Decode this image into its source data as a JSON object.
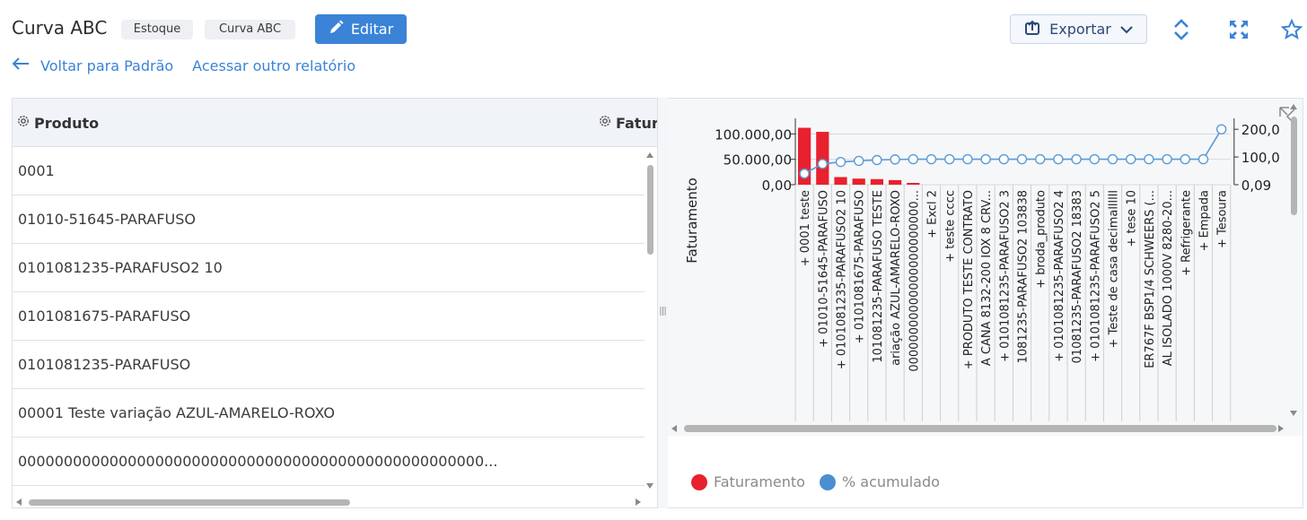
{
  "header": {
    "title": "Curva ABC",
    "chips": [
      "Estoque",
      "Curva ABC"
    ],
    "edit_label": "Editar",
    "export_label": "Exportar",
    "back_link": "Voltar para Padrão",
    "other_report_link": "Acessar outro relatório"
  },
  "table": {
    "columns": [
      "Produto",
      "Fatur"
    ],
    "rows": [
      "0001",
      "01010-51645-PARAFUSO",
      "0101081235-PARAFUSO2 10",
      "0101081675-PARAFUSO",
      "0101081235-PARAFUSO",
      "00001 Teste variação AZUL-AMARELO-ROXO",
      "000000000000000000000000000000000000000000000000000..."
    ]
  },
  "chart_data": {
    "type": "bar",
    "ylabel": "Faturamento",
    "y_ticks": [
      "100.000,00",
      "50.000,00",
      "0,00"
    ],
    "y2_ticks": [
      "200,0",
      "100,0",
      "0,09"
    ],
    "categories": [
      "+ 0001 teste",
      "+ 01010-51645-PARAFUSO",
      "+ 0101081235-PARAFUSO2 10",
      "+ 0101081675-PARAFUSO",
      "101081235-PARAFUSO TESTE",
      "ariação AZUL-AMARELO-ROXO",
      "00000000000000000000000...",
      "+ Excl 2",
      "+ teste cccc",
      "+ PRODUTO TESTE CONTRATO",
      "A CANA 8132-200 IOX 8 CRV...",
      "+ 0101081235-PARAFUSO2 3",
      "1081235-PARAFUSO2 103838",
      "+ broda_produto",
      "+ 0101081235-PARAFUSO2 4",
      "01081235-PARAFUSO2 18383",
      "+ 0101081235-PARAFUSO2 5",
      "+ Teste de casa decimallllll",
      "+ tese 10",
      "ER767F BSP1/4 SCHWEERS (...",
      "AL ISOLADO 1000V 8280-20...",
      "+ Refrigerante",
      "+ Empada",
      "+ Tesoura"
    ],
    "series": [
      {
        "name": "Faturamento",
        "values": [
          112000,
          104000,
          15000,
          12000,
          11000,
          9000,
          3500,
          0,
          0,
          0,
          0,
          0,
          0,
          0,
          0,
          0,
          0,
          0,
          0,
          0,
          0,
          0,
          0,
          0
        ]
      },
      {
        "name": "% acumulado",
        "values": [
          40,
          75,
          82,
          86,
          89,
          91,
          92,
          92,
          92,
          92,
          92,
          92,
          92,
          92,
          92,
          92,
          92,
          92,
          92,
          92,
          92,
          92,
          92,
          200
        ]
      }
    ],
    "ylim": [
      0,
      120000
    ],
    "y2lim": [
      0,
      220
    ],
    "colors": {
      "bar": "#e8212e",
      "line": "#5b9bd5"
    }
  },
  "legend": [
    {
      "label": "Faturamento",
      "color": "#e8212e"
    },
    {
      "label": "% acumulado",
      "color": "#4a90d0"
    }
  ]
}
